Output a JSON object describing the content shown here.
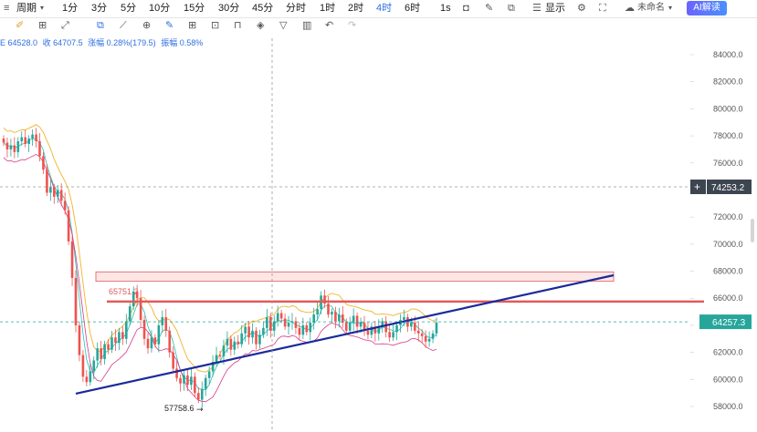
{
  "toolbar": {
    "items": [
      "周期",
      "1分",
      "3分",
      "5分",
      "10分",
      "15分",
      "30分",
      "45分",
      "分时",
      "1时",
      "2时",
      "4时",
      "6时",
      "1s"
    ],
    "active": "4时",
    "display_label": "显示",
    "layout_name": "未命名",
    "ai_label": "AI解读"
  },
  "info": {
    "open_text": "E 64528.0",
    "close_text": "收 64707.5",
    "change_text": "涨幅 0.28%(179.5)",
    "amplitude_text": "振幅 0.58%"
  },
  "colors": {
    "up": "#26a69a",
    "down": "#ef5350",
    "trendline": "#1a2a9c",
    "resistance": "#e05a5a",
    "zone": "#f6b8b8",
    "price_tag": "#3d4551"
  },
  "chart_data": {
    "type": "candlestick",
    "y_range": [
      57000,
      85000
    ],
    "y_ticks": [
      58000,
      60000,
      62000,
      64000,
      66000,
      68000,
      70000,
      72000,
      74000,
      76000,
      78000,
      80000,
      82000,
      84000
    ],
    "y_tick_labels": [
      "58000.0",
      "60000.0",
      "62000.0",
      "64000.0",
      "66000.0",
      "68000.0",
      "70000.0",
      "72000.0",
      "74000.0",
      "76000.0",
      "78000.0",
      "80000.0",
      "82000.0",
      "84000.0"
    ],
    "crosshair_price": "74253.2",
    "current_price": "64257.3",
    "low_label": "57758.6",
    "resistance_label": "65751.2",
    "resistance_level": 65751.2,
    "zone": [
      67250,
      67950
    ],
    "trendline": [
      {
        "i": 0,
        "price": 58950
      },
      {
        "i": 140,
        "price": 67700
      }
    ],
    "closes": [
      77500,
      77000,
      77300,
      76800,
      77600,
      77900,
      77400,
      77800,
      78100,
      77600,
      76500,
      75500,
      73800,
      74200,
      73500,
      74000,
      73200,
      72500,
      70200,
      67500,
      64000,
      61800,
      60200,
      59800,
      60600,
      61400,
      62300,
      61500,
      62600,
      62200,
      63100,
      62700,
      63500,
      63000,
      64300,
      65400,
      66500,
      66000,
      64400,
      63000,
      62300,
      63100,
      62600,
      64000,
      64600,
      63600,
      62000,
      60800,
      60100,
      59700,
      60300,
      59600,
      60200,
      59000,
      58500,
      59300,
      60100,
      60600,
      61300,
      61800,
      61700,
      62500,
      63000,
      62200,
      62800,
      62600,
      63400,
      63900,
      63100,
      63600,
      62600,
      63300,
      63800,
      64600,
      63600,
      64300,
      64900,
      64500,
      63900,
      64200,
      64300,
      63800,
      63300,
      64000,
      63500,
      64200,
      64800,
      65200,
      66200,
      65600,
      64800,
      65000,
      64300,
      64800,
      64200,
      63600,
      64200,
      64700,
      63900,
      64200,
      63600,
      63300,
      63900,
      63400,
      63900,
      64300,
      63500,
      63100,
      63500,
      64000,
      64400,
      64600,
      63900,
      64200,
      63600,
      63400,
      63200,
      62800,
      63000,
      63400,
      64200
    ]
  }
}
